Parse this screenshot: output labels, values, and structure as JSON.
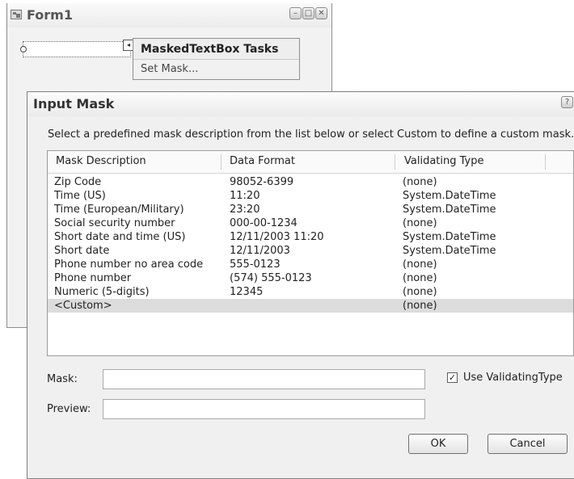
{
  "form1": {
    "title": "Form1",
    "window_buttons": [
      "–",
      "□",
      "✕"
    ]
  },
  "tasks_panel": {
    "header": "MaskedTextBox Tasks",
    "link": "Set Mask...",
    "smart_tag_glyph": "◂"
  },
  "dialog": {
    "title": "Input Mask",
    "help_glyph": "?",
    "close_glyph": "✕",
    "instructions": "Select a predefined mask description from the list below or select Custom to define a custom mask.",
    "columns": [
      "Mask Description",
      "Data Format",
      "Validating Type"
    ],
    "rows": [
      {
        "description": "Zip Code",
        "format": "98052-6399",
        "type": "(none)"
      },
      {
        "description": "Time (US)",
        "format": "11:20",
        "type": "System.DateTime"
      },
      {
        "description": "Time (European/Military)",
        "format": "23:20",
        "type": "System.DateTime"
      },
      {
        "description": "Social security number",
        "format": "000-00-1234",
        "type": "(none)"
      },
      {
        "description": "Short date and time (US)",
        "format": "12/11/2003 11:20",
        "type": "System.DateTime"
      },
      {
        "description": "Short date",
        "format": "12/11/2003",
        "type": "System.DateTime"
      },
      {
        "description": "Phone number no area code",
        "format": "555-0123",
        "type": "(none)"
      },
      {
        "description": "Phone number",
        "format": "(574) 555-0123",
        "type": "(none)"
      },
      {
        "description": "Numeric (5-digits)",
        "format": "12345",
        "type": "(none)"
      },
      {
        "description": "<Custom>",
        "format": "",
        "type": "(none)"
      }
    ],
    "mask_label": "Mask:",
    "mask_value": "",
    "preview_label": "Preview:",
    "preview_value": "",
    "use_validating_type_label": "Use ValidatingType",
    "use_validating_type_checked": true,
    "check_glyph": "✓",
    "ok_label": "OK",
    "cancel_label": "Cancel"
  }
}
